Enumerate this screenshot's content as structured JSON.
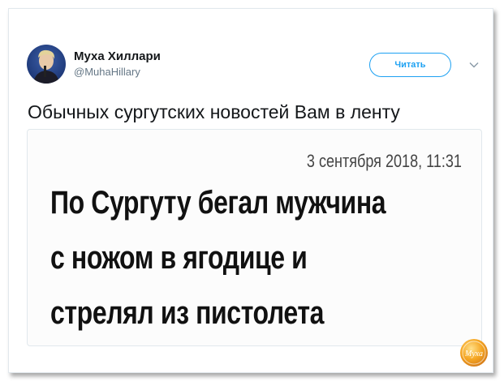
{
  "tweet": {
    "display_name": "Муха Хиллари",
    "handle": "@MuhaHillary",
    "follow_label": "Читать",
    "text": "Обычных сургутских новостей Вам в ленту"
  },
  "media": {
    "date": "3 сентября 2018, 11:31",
    "headline_lines": [
      "По Сургуту бегал мужчина",
      "с ножом в ягодице и",
      "стрелял из пистолета"
    ]
  },
  "watermark": {
    "text": "Муха"
  },
  "colors": {
    "accent": "#1da1f2",
    "border": "#e1e8ed",
    "text": "#14171a",
    "muted": "#657786"
  },
  "icons": {
    "caret": "chevron-down-icon",
    "avatar": "avatar"
  }
}
